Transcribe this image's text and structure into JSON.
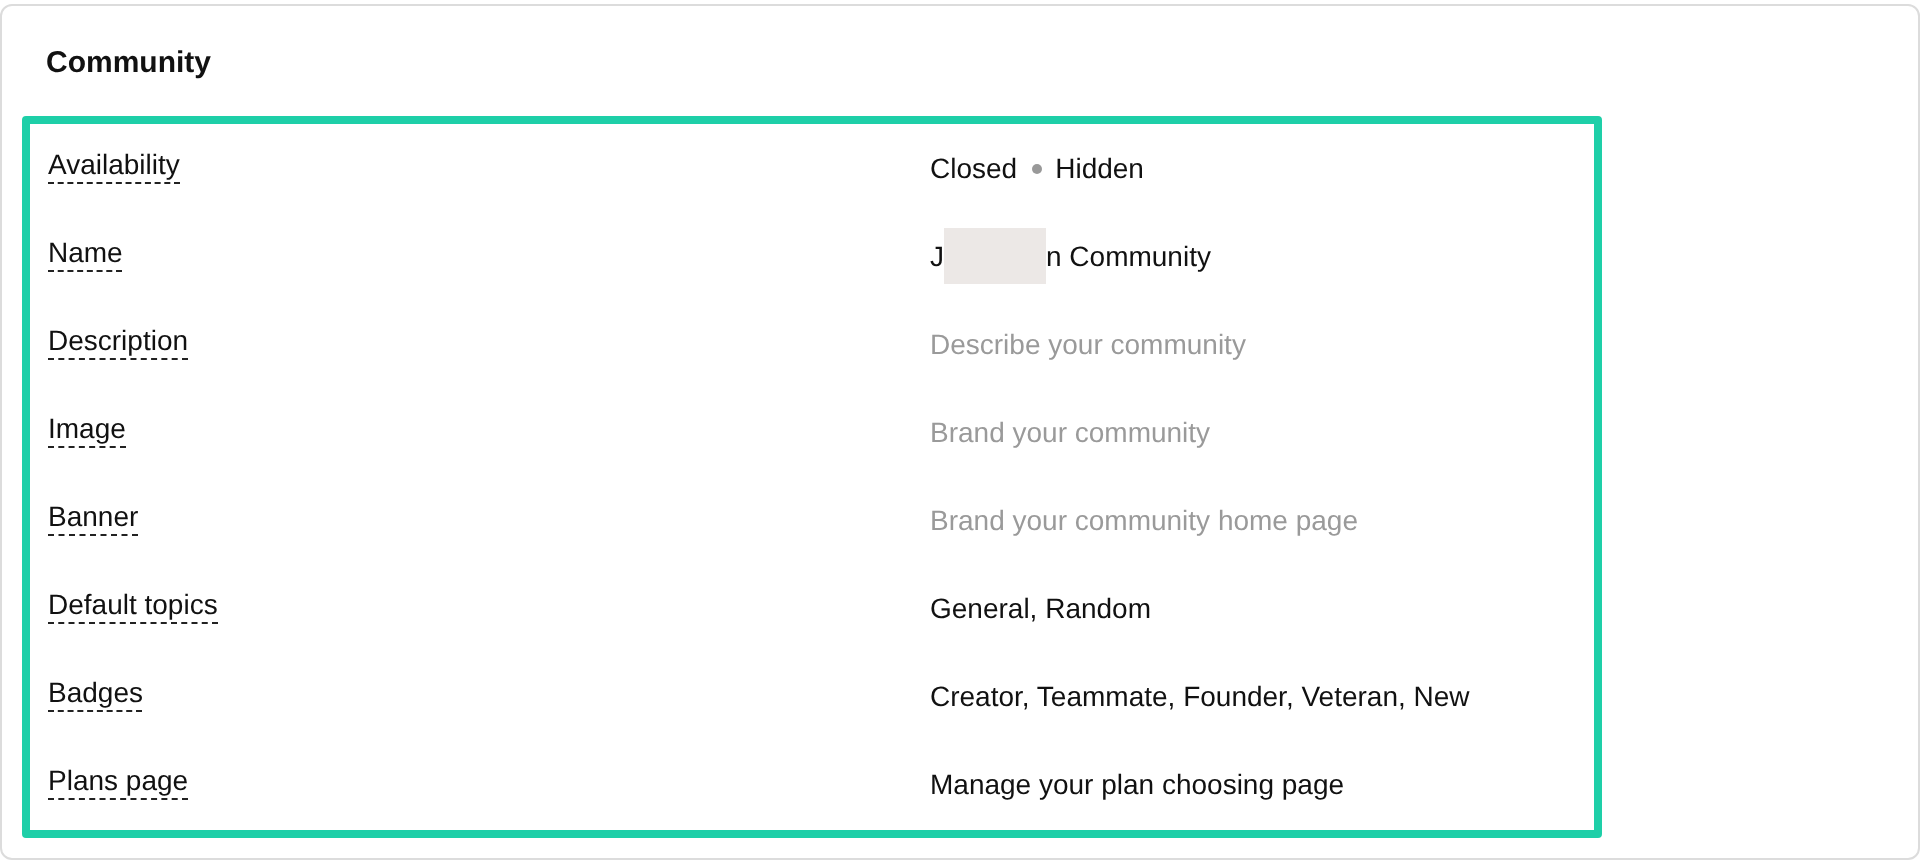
{
  "title": "Community",
  "rows": [
    {
      "label": "Availability",
      "kind": "status",
      "values": [
        "Closed",
        "Hidden"
      ]
    },
    {
      "label": "Name",
      "kind": "redacted",
      "before": "J",
      "after": "n Community"
    },
    {
      "label": "Description",
      "kind": "hint",
      "value": "Describe your community"
    },
    {
      "label": "Image",
      "kind": "hint",
      "value": "Brand your community"
    },
    {
      "label": "Banner",
      "kind": "hint",
      "value": "Brand your community home page"
    },
    {
      "label": "Default topics",
      "kind": "text",
      "value": "General, Random"
    },
    {
      "label": "Badges",
      "kind": "text",
      "value": "Creator, Teammate, Founder, Veteran, New"
    },
    {
      "label": "Plans page",
      "kind": "text",
      "value": "Manage your plan choosing page"
    }
  ]
}
